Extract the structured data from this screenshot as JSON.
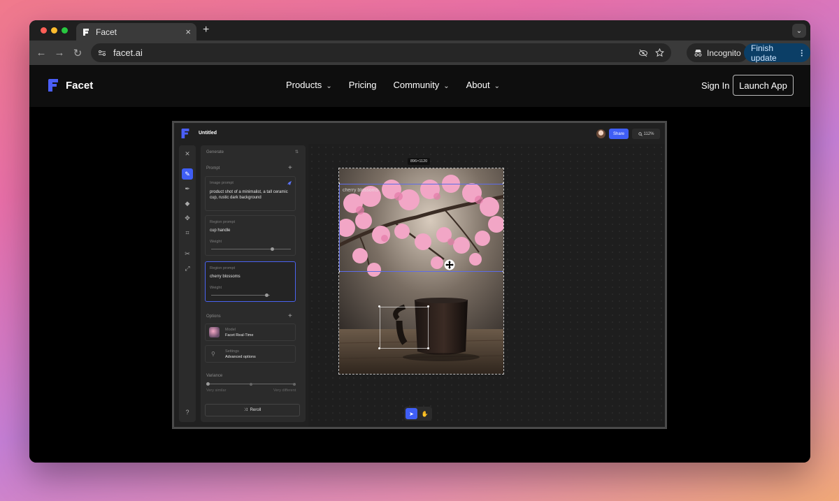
{
  "browser": {
    "tab_title": "Facet",
    "close_glyph": "×",
    "new_tab_glyph": "+",
    "tab_menu_glyph": "⌄",
    "url": "facet.ai",
    "incognito_label": "Incognito",
    "finish_update_label": "Finish update",
    "nav_back": "←",
    "nav_forward": "→",
    "nav_reload": "↻",
    "colors": {
      "traffic_red": "#ff5f57",
      "traffic_yellow": "#febc2e",
      "traffic_green": "#28c840",
      "update_blue": "#0b3e66"
    }
  },
  "site": {
    "brand": "Facet",
    "nav": [
      {
        "label": "Products",
        "has_dropdown": true
      },
      {
        "label": "Pricing",
        "has_dropdown": false
      },
      {
        "label": "Community",
        "has_dropdown": true
      },
      {
        "label": "About",
        "has_dropdown": true
      }
    ],
    "sign_in": "Sign In",
    "launch_app": "Launch App",
    "accent": "#3f5ef5"
  },
  "app": {
    "doc_title": "Untitled",
    "share_label": "Share",
    "zoom_label": "112%",
    "panel": {
      "header": "Generate",
      "prompt_section": "Prompt",
      "image_prompt_label": "Image prompt",
      "image_prompt_text": "product shot of a minimalist, a tall ceramic cup, rustic dark background",
      "region1_label": "Region prompt",
      "region1_text": "cup handle",
      "region1_weight_label": "Weight",
      "region1_weight": 0.76,
      "region2_label": "Region prompt",
      "region2_text": "cherry blossoms",
      "region2_weight_label": "Weight",
      "region2_weight": 0.76,
      "options_section": "Options",
      "model_label": "Model",
      "model_value": "Facet Real-Time",
      "settings_label": "Settings",
      "settings_value": "Advanced options",
      "variance_label": "Variance",
      "variance_min": "Very similar",
      "variance_max": "Very different",
      "reroll_label": "Reroll"
    },
    "canvas": {
      "dimensions": "896×1120",
      "region_overlay_label": "cherry blossoms"
    }
  },
  "icons": {
    "browser": [
      "eye-off-icon",
      "star-icon",
      "incognito-icon",
      "more-vert-icon"
    ],
    "tools": [
      "close-icon",
      "pencil-icon",
      "pen-icon",
      "eraser-icon",
      "move-icon",
      "crop-icon",
      "cut-icon",
      "expand-icon",
      "help-icon"
    ]
  }
}
